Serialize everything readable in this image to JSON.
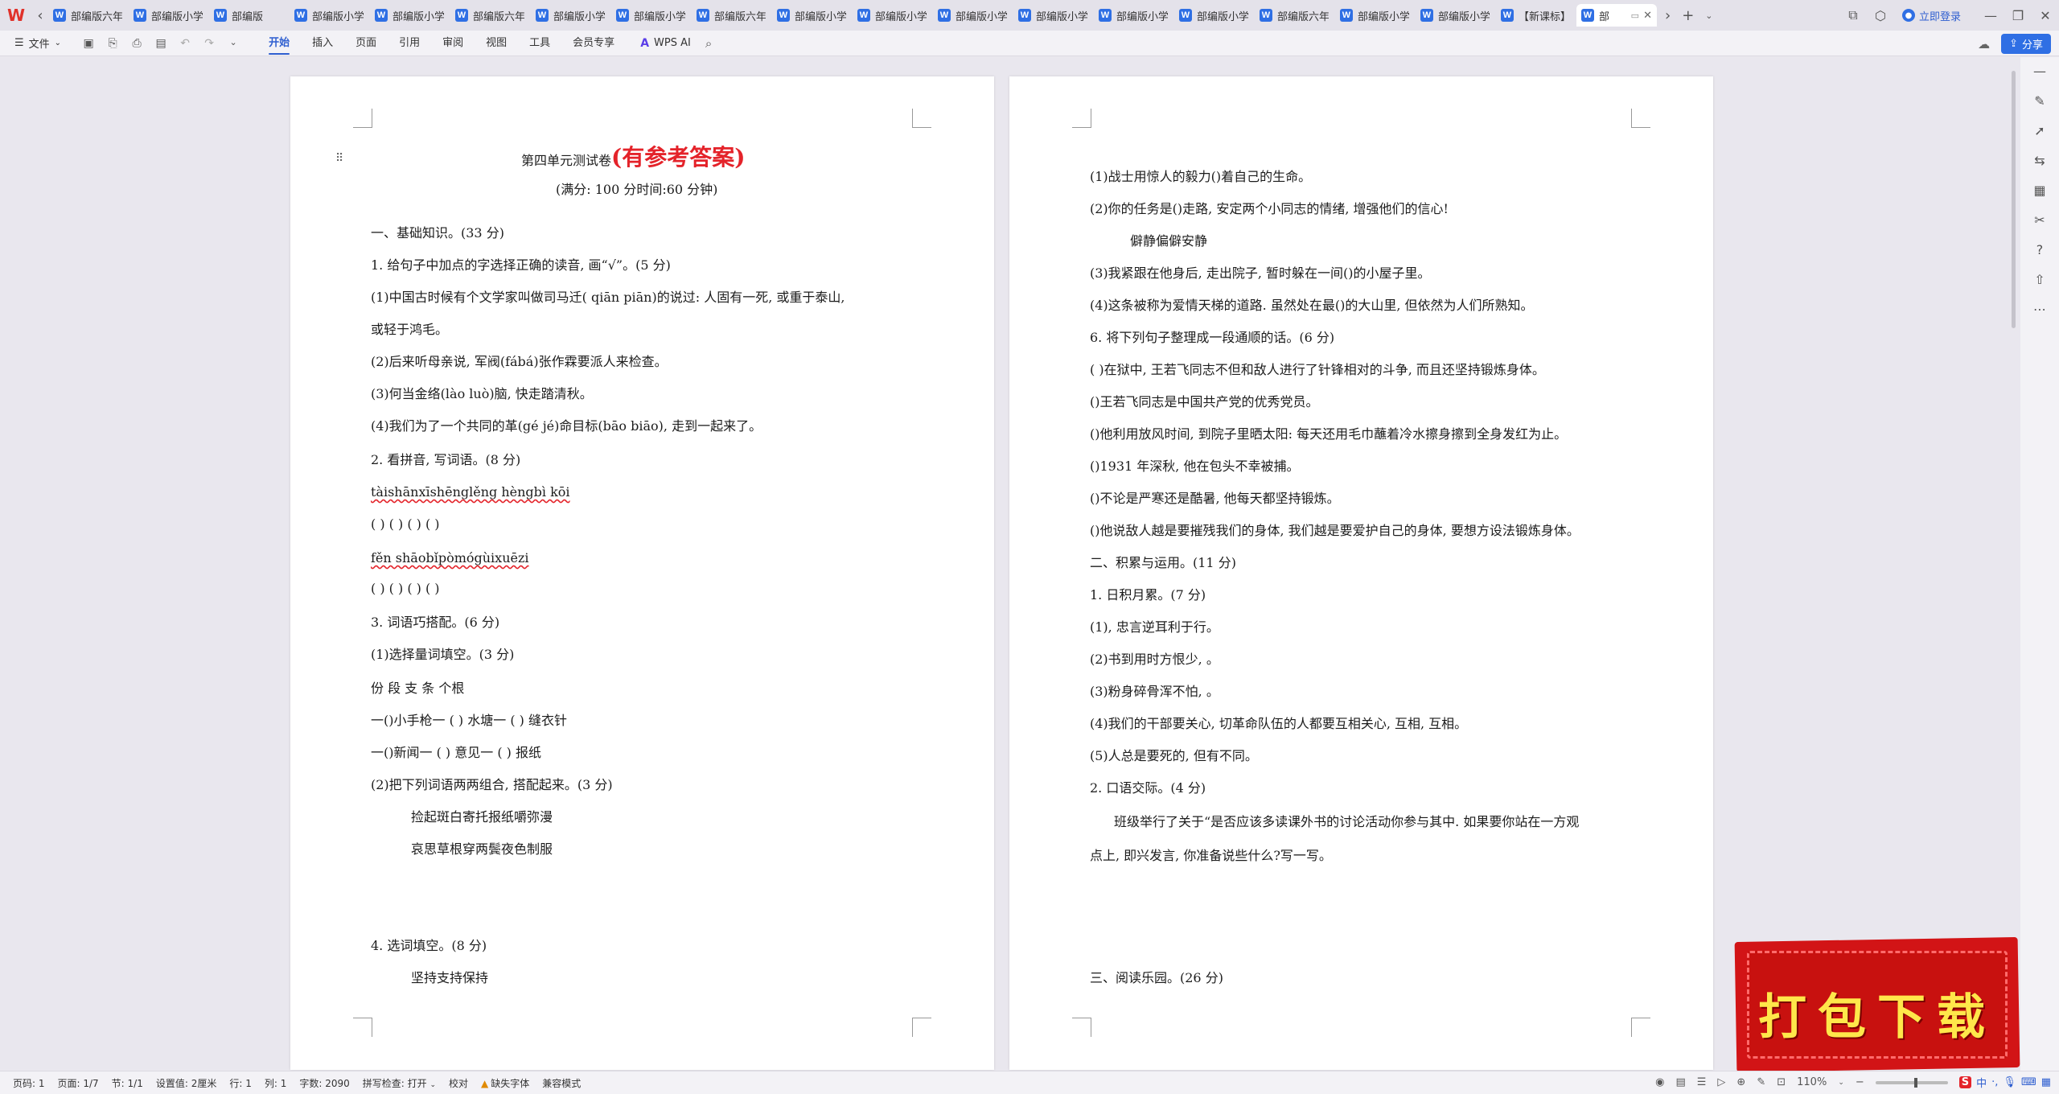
{
  "app": {
    "logo": "W",
    "tabs": [
      {
        "label": "部编版六年"
      },
      {
        "label": "部编版小学"
      },
      {
        "label": "部编版"
      },
      {
        "label": "部编版小学"
      },
      {
        "label": "部编版小学"
      },
      {
        "label": "部编版六年"
      },
      {
        "label": "部编版小学"
      },
      {
        "label": "部编版小学"
      },
      {
        "label": "部编版六年"
      },
      {
        "label": "部编版小学"
      },
      {
        "label": "部编版小学"
      },
      {
        "label": "部编版小学"
      },
      {
        "label": "部编版小学"
      },
      {
        "label": "部编版小学"
      },
      {
        "label": "部编版小学"
      },
      {
        "label": "部编版六年"
      },
      {
        "label": "部编版小学"
      },
      {
        "label": "部编版小学"
      },
      {
        "label": "【新课标】"
      }
    ],
    "active_tab": {
      "label": "部"
    },
    "login_label": "立即登录"
  },
  "menubar": {
    "file_label": "文件",
    "tabs": [
      "开始",
      "插入",
      "页面",
      "引用",
      "审阅",
      "视图",
      "工具",
      "会员专享"
    ],
    "active_tab": "开始",
    "wps_ai_label": "WPS AI",
    "share_label": "分享"
  },
  "page1": {
    "title_main": "第四单元测试卷",
    "title_red": "(有参考答案)",
    "subtitle": "(满分: 100 分时间:60 分钟)",
    "lines": [
      "一、基础知识。(33 分)",
      "1. 给句子中加点的字选择正确的读音, 画“√”。(5 分)",
      "(1)中国古时候有个文学家叫做司马迁( qiān piān)的说过: 人固有一死, 或重于泰山,",
      "或轻于鸿毛。",
      "(2)后来听母亲说, 军阀(fábá)张作霖要派人来检查。",
      "(3)何当金络(lào luò)脑, 快走踏清秋。",
      "(4)我们为了一个共同的革(gé jé)命目标(bāo biāo), 走到一起来了。",
      "2. 看拼音, 写词语。(8 分)",
      "tàishānxīshēnglěng hèngbì kōi",
      "(    )                 ( )  ( )  ( )",
      "fěn shāobǐpòmógùixuēzi",
      "(    )                 ( )  ( )  ( )",
      "3. 词语巧搭配。(6 分)",
      "(1)选择量词填空。(3 分)",
      "份 段 支 条 个根",
      "一()小手枪一 ( ) 水塘一 ( ) 缝衣针",
      "一()新闻一 ( ) 意见一 ( ) 报纸",
      "(2)把下列词语两两组合, 搭配起来。(3 分)",
      "捡起斑白寄托报纸嚼弥漫",
      "哀思草根穿两鬓夜色制服",
      "4. 选词填空。(8 分)",
      "坚持支持保持"
    ]
  },
  "page2": {
    "lines": [
      "(1)战士用惊人的毅力()着自己的生命。",
      "(2)你的任务是()走路, 安定两个小同志的情绪, 增强他们的信心!",
      "僻静偏僻安静",
      "(3)我紧跟在他身后, 走出院子, 暂时躲在一间()的小屋子里。",
      "(4)这条被称为爱情天梯的道路. 虽然处在最()的大山里, 但依然为人们所熟知。",
      "6. 将下列句子整理成一段通顺的话。(6 分)",
      "(     )在狱中, 王若飞同志不但和敌人进行了针锋相对的斗争, 而且还坚持锻炼身体。",
      "()王若飞同志是中国共产党的优秀党员。",
      "()他利用放风时间, 到院子里晒太阳: 每天还用毛巾蘸着冷水擦身擦到全身发红为止。",
      "()1931 年深秋, 他在包头不幸被捕。",
      "()不论是严寒还是酷暑, 他每天都坚持锻炼。",
      "()他说敌人越是要摧残我们的身体, 我们越是要爱护自己的身体, 要想方设法锻炼身体。",
      "二、积累与运用。(11 分)",
      "1. 日积月累。(7 分)",
      "(1), 忠言逆耳利于行。",
      "(2)书到用时方恨少, 。",
      "(3)粉身碎骨浑不怕, 。",
      "(4)我们的干部要关心, 切革命队伍的人都要互相关心, 互相, 互相。",
      "(5)人总是要死的, 但有不同。",
      "2. 口语交际。(4 分)",
      "班级举行了关于“是否应该多读课外书的讨论活动你参与其中. 如果要你站在一方观",
      "点上, 即兴发言, 你准备说些什么?写一写。",
      "三、阅读乐园。(26 分)"
    ]
  },
  "badge": {
    "text": "打包下载"
  },
  "statusbar": {
    "page_code": "页码: 1",
    "page_count": "页面: 1/7",
    "section": "节: 1/1",
    "setting": "设置值: 2厘米",
    "row": "行: 1",
    "col": "列: 1",
    "word_count": "字数: 2090",
    "spell_check": "拼写检查: 打开",
    "proofread": "校对",
    "missing_font": "缺失字体",
    "compat_mode": "兼容模式",
    "zoom": "110%",
    "ime": "中"
  }
}
